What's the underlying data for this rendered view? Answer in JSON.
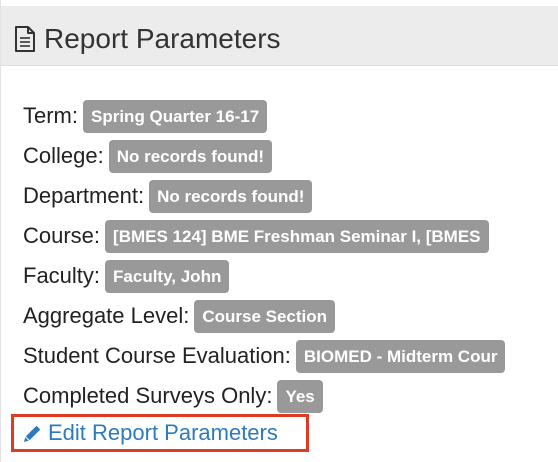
{
  "header": {
    "title": "Report Parameters",
    "icon": "document-icon"
  },
  "params": {
    "term": {
      "label": "Term:",
      "value": "Spring Quarter 16-17"
    },
    "college": {
      "label": "College:",
      "value": "No records found!"
    },
    "department": {
      "label": "Department:",
      "value": "No records found!"
    },
    "course": {
      "label": "Course:",
      "value": "[BMES 124] BME Freshman Seminar I, [BMES"
    },
    "faculty": {
      "label": "Faculty:",
      "value": "Faculty, John"
    },
    "aggregate_level": {
      "label": "Aggregate Level:",
      "value": "Course Section"
    },
    "student_course_evaluation": {
      "label": "Student Course Evaluation:",
      "value": "BIOMED - Midterm Cour"
    },
    "completed_surveys_only": {
      "label": "Completed Surveys Only:",
      "value": "Yes"
    }
  },
  "edit_link": {
    "label": "Edit Report Parameters",
    "icon": "pencil-icon"
  },
  "colors": {
    "badge_bg": "#999999",
    "link": "#2d7bbf",
    "highlight_border": "#e03a24",
    "header_bg": "#ececec"
  }
}
